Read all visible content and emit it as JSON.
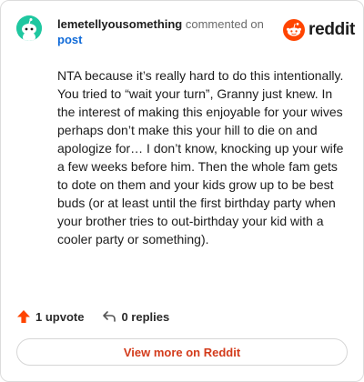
{
  "header": {
    "username": "lemetellyousomething",
    "action": "commented on",
    "post_link": "post",
    "logo_text": "reddit",
    "avatar_icon": "reddit-snoo-avatar-icon",
    "logo_icon": "reddit-logo-icon"
  },
  "comment": {
    "body": "NTA because it’s really hard to do this intentionally. You tried to “wait your turn”, Granny just knew. In the interest of making this enjoyable for your wives perhaps don’t make this your hill to die on and apologize for… I don’t know, knocking up your wife a few weeks before him. Then the whole fam gets to dote on them and your kids grow up to be best buds (or at least until the first birthday party when your brother tries to out-birthday your kid with a cooler party or something)."
  },
  "actions": {
    "upvote_label": "1 upvote",
    "replies_label": "0 replies",
    "upvote_icon": "upvote-arrow-icon",
    "reply_icon": "reply-arrow-icon"
  },
  "footer": {
    "view_more_label": "View more on Reddit"
  },
  "colors": {
    "avatar": "#1fc7a0",
    "brand": "#ff4500",
    "link": "#0f6ad8",
    "view_more": "#d33b1b"
  }
}
